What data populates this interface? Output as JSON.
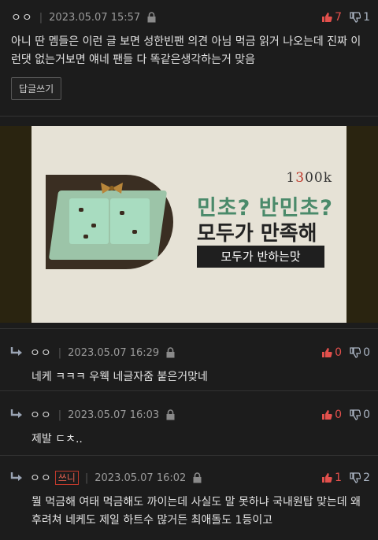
{
  "post": {
    "author": "ㅇㅇ",
    "date": "2023.05.07 15:57",
    "up": "7",
    "down": "1",
    "text": "아니 딴 멤들은 이런 글 보면 성한빈팬 의견 아님 먹금 읽거 나오는데 진짜 이런댓 없는거보면 얘네 팬들 다 똑같은생각하는거 맞음",
    "reply_button": "답글쓰기"
  },
  "ad_image": {
    "logo_prefix": "1",
    "logo_mid": "3",
    "logo_suffix": "00k",
    "headline1": "민초? 반민초?",
    "headline2": "모두가 만족해",
    "tagline": "모두가 반하는맛"
  },
  "replies": [
    {
      "author": "ㅇㅇ",
      "badge": "",
      "date": "2023.05.07 16:29",
      "up": "0",
      "down": "0",
      "text": "네케 ㅋㅋㅋ 우웩 네글자줌 붙은거맞네"
    },
    {
      "author": "ㅇㅇ",
      "badge": "",
      "date": "2023.05.07 16:03",
      "up": "0",
      "down": "0",
      "text": "제발 ㄷㅊ.."
    },
    {
      "author": "ㅇㅇ",
      "badge": "쓰니",
      "date": "2023.05.07 16:02",
      "up": "1",
      "down": "2",
      "text": "뭘 먹금해 여태 먹금해도 까이는데 사실도 말 못하냐 국내원탑 맞는데 왜 후려쳐 네케도 제일 하트수 많거든 최애돌도 1등이고"
    }
  ],
  "icons": {
    "lock": "lock-icon",
    "thumb_up": "thumbs-up-icon",
    "thumb_down": "thumbs-down-icon",
    "reply_arrow": "reply-arrow-icon"
  },
  "colors": {
    "upvote": "#e2504c",
    "downvote": "#aab4c2",
    "background": "#1c1c1c",
    "op_badge": "#c0392b"
  }
}
